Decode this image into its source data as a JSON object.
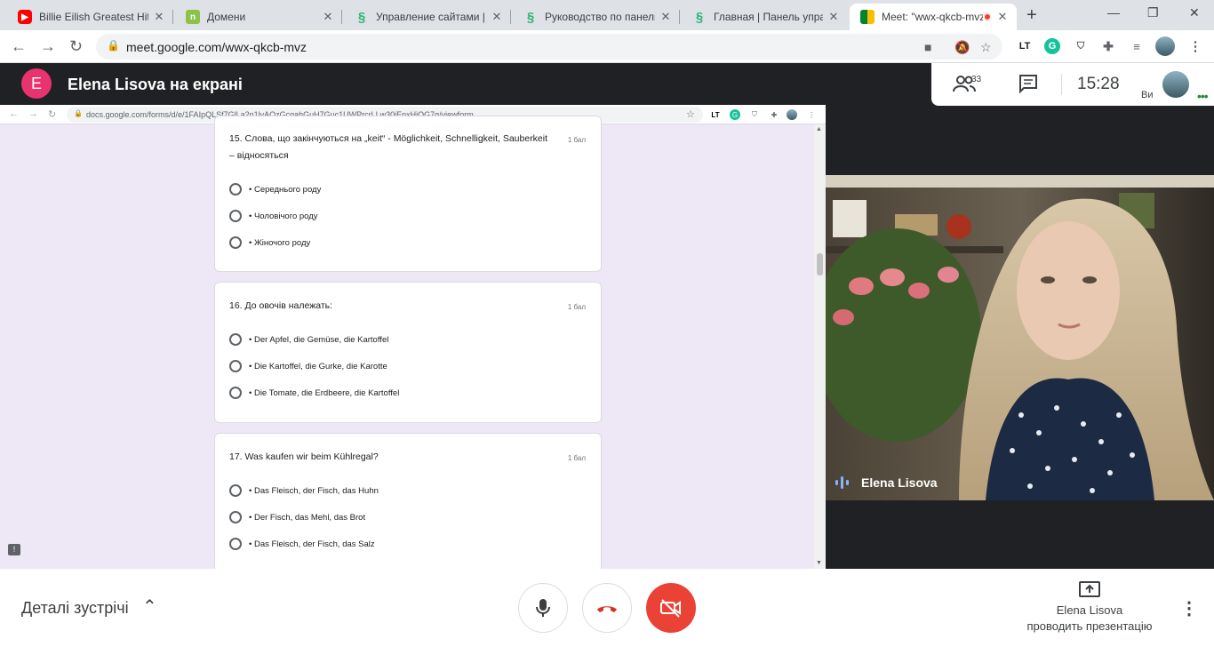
{
  "tabs": [
    {
      "title": "Billie Eilish Greatest Hits",
      "icon": "youtube-icon"
    },
    {
      "title": "Домени",
      "icon": "n-icon"
    },
    {
      "title": "Управление сайтами |",
      "icon": "s-icon"
    },
    {
      "title": "Руководство по панели",
      "icon": "s-icon"
    },
    {
      "title": "Главная | Панель управ",
      "icon": "s-icon"
    },
    {
      "title": "Meet: \"wwx-qkcb-mvz\"",
      "icon": "meet-icon",
      "active": true
    }
  ],
  "address_bar": {
    "url": "meet.google.com/wwx-qkcb-mvz"
  },
  "meet": {
    "presenter_initial": "E",
    "presenter_title": "Elena Lisova на екрані",
    "participant_count": "33",
    "time": "15:28",
    "self_label": "Ви",
    "video_name": "Elena Lisova",
    "details_label": "Деталі зустрічі",
    "presenting_line1": "Elena Lisova",
    "presenting_line2": "проводить презентацію"
  },
  "shared_screen": {
    "url": "docs.google.com/forms/d/e/1FAIpQLSf7GlLa2n1lvAOzGcqahGuH7Guc1UWPrcrLLw30iEnxHjOG7g/viewform",
    "questions": [
      {
        "text": "15. Слова, що закінчуються на „keit“ - Möglichkeit, Schnelligkeit, Sauberkeit – відносяться",
        "points": "1 бал",
        "options": [
          "• Середнього роду",
          "• Чоловічого роду",
          "• Жіночого роду"
        ]
      },
      {
        "text": "16. До овочів належать:",
        "points": "1 бал",
        "options": [
          "• Der Apfel, die Gemüse, die Kartoffel",
          "• Die Kartoffel, die Gurke, die Karotte",
          "• Die Tomate, die Erdbeere, die Kartoffel"
        ]
      },
      {
        "text": "17. Was kaufen wir beim Kühlregal?",
        "points": "1 бал",
        "options": [
          "• Das Fleisch, der Fisch, das Huhn",
          "• Der Fisch, das Mehl, das Brot",
          "• Das Fleisch, der Fisch, das Salz"
        ]
      }
    ]
  },
  "colors": {
    "accent_red": "#ea4335",
    "form_bg": "#ede7f6",
    "avatar": "#e8336f"
  }
}
